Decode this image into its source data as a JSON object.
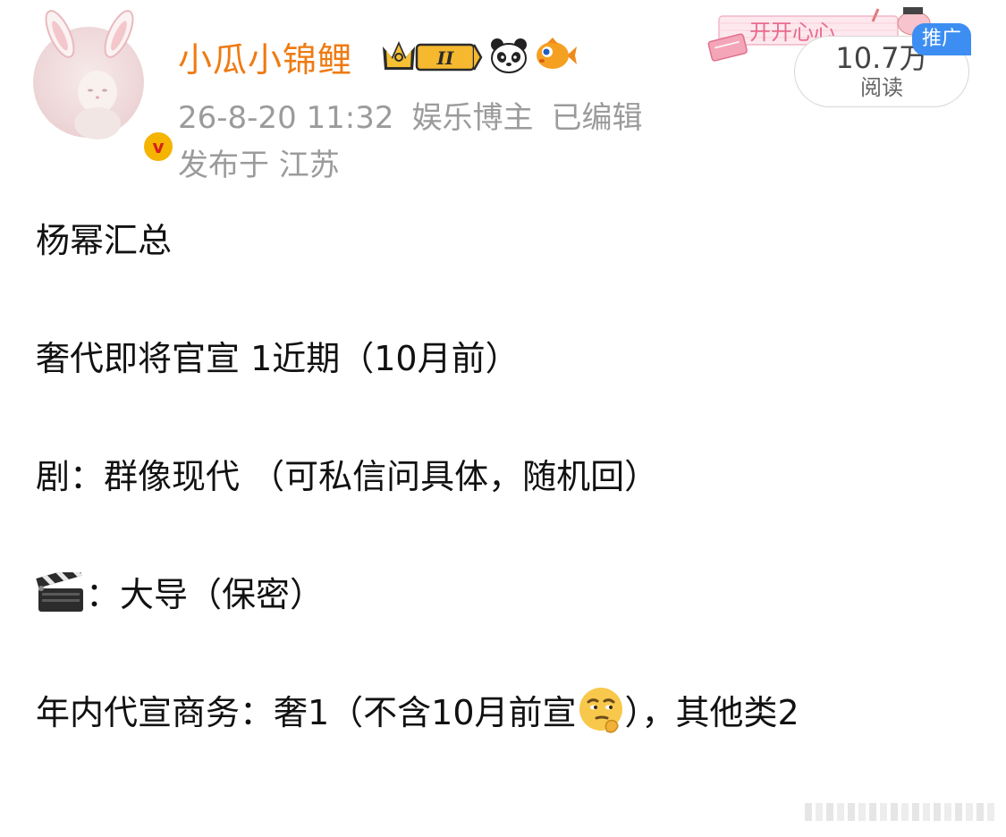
{
  "user": {
    "name": "小瓜小锦鲤",
    "vip_badge": "II"
  },
  "post_meta": {
    "timestamp": "26-8-20 11:32",
    "category": "娱乐博主",
    "edited": "已编辑",
    "location": "发布于 江苏"
  },
  "stats": {
    "reads_count": "10.7万",
    "reads_label": "阅读",
    "promo_tag": "推广"
  },
  "decoration": {
    "sticker_text": "开开心心"
  },
  "post": {
    "line1": "杨幂汇总",
    "line2": "奢代即将官宣 1近期（10月前）",
    "line3": "剧：群像现代 （可私信问具体，随机回）",
    "line4_text": "：大导（保密）",
    "line5_a": "年内代宣商务：奢1（不含10月前宣",
    "line5_b": "），其他类2"
  },
  "icons": {
    "clapper": "clapperboard-icon",
    "thinking": "thinking-face-icon",
    "crown": "crown-icon",
    "panda": "panda-icon",
    "fish": "goldfish-icon"
  },
  "colors": {
    "username": "#ef7a12",
    "meta": "#9b9b9b",
    "promo": "#3d8ef2"
  }
}
